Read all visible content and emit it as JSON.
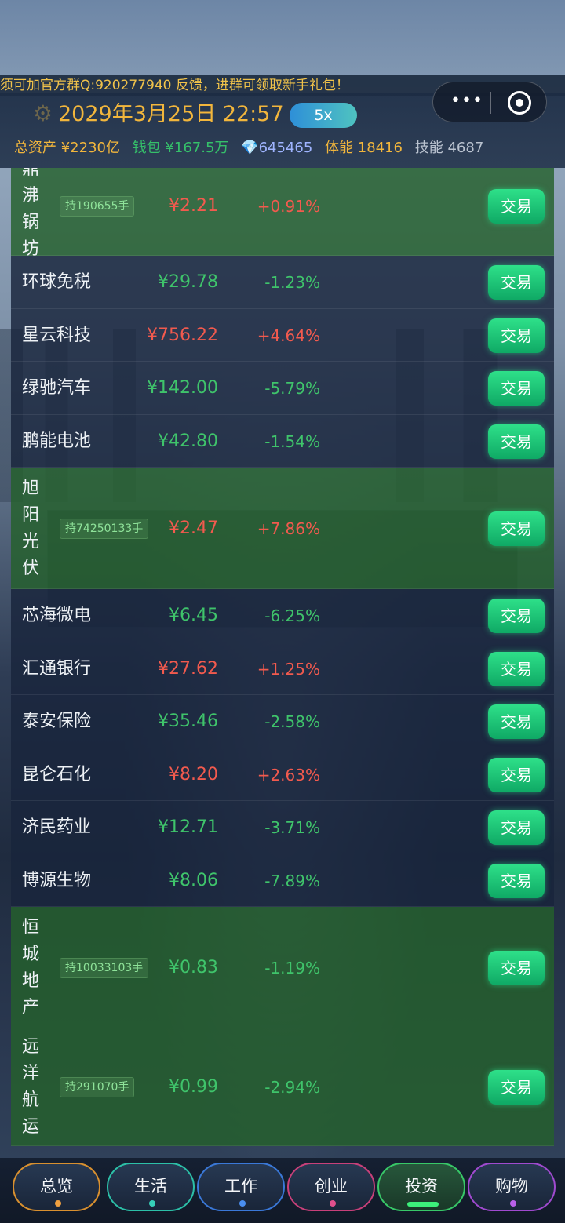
{
  "notice": "须可加官方群Q:920277940 反馈，进群可领取新手礼包！",
  "header": {
    "datetime": "2029年3月25日 22:57",
    "speed": "5x",
    "more_label": "•••",
    "stats": {
      "assets": "总资产 ¥2230亿",
      "wallet": "钱包 ¥167.5万",
      "gems": "💎645465",
      "stamina": "体能 18416",
      "skill": "技能 4687"
    }
  },
  "trade_label": "交易",
  "stocks": [
    {
      "name": "鼎沸锅坊",
      "holding": "持190655手",
      "price": "¥2.21",
      "change": "+0.91%",
      "direction": "up"
    },
    {
      "name": "环球免税",
      "holding": "",
      "price": "¥29.78",
      "change": "-1.23%",
      "direction": "down"
    },
    {
      "name": "星云科技",
      "holding": "",
      "price": "¥756.22",
      "change": "+4.64%",
      "direction": "up"
    },
    {
      "name": "绿驰汽车",
      "holding": "",
      "price": "¥142.00",
      "change": "-5.79%",
      "direction": "down"
    },
    {
      "name": "鹏能电池",
      "holding": "",
      "price": "¥42.80",
      "change": "-1.54%",
      "direction": "down"
    },
    {
      "name": "旭阳光伏",
      "holding": "持74250133手",
      "price": "¥2.47",
      "change": "+7.86%",
      "direction": "up"
    },
    {
      "name": "芯海微电",
      "holding": "",
      "price": "¥6.45",
      "change": "-6.25%",
      "direction": "down"
    },
    {
      "name": "汇通银行",
      "holding": "",
      "price": "¥27.62",
      "change": "+1.25%",
      "direction": "up"
    },
    {
      "name": "泰安保险",
      "holding": "",
      "price": "¥35.46",
      "change": "-2.58%",
      "direction": "down"
    },
    {
      "name": "昆仑石化",
      "holding": "",
      "price": "¥8.20",
      "change": "+2.63%",
      "direction": "up"
    },
    {
      "name": "济民药业",
      "holding": "",
      "price": "¥12.71",
      "change": "-3.71%",
      "direction": "down"
    },
    {
      "name": "博源生物",
      "holding": "",
      "price": "¥8.06",
      "change": "-7.89%",
      "direction": "down"
    },
    {
      "name": "恒城地产",
      "holding": "持10033103手",
      "price": "¥0.83",
      "change": "-1.19%",
      "direction": "down"
    },
    {
      "name": "远洋航运",
      "holding": "持291070手",
      "price": "¥0.99",
      "change": "-2.94%",
      "direction": "down"
    }
  ],
  "tabs": [
    {
      "label": "总览"
    },
    {
      "label": "生活"
    },
    {
      "label": "工作"
    },
    {
      "label": "创业"
    },
    {
      "label": "投资",
      "active": true
    },
    {
      "label": "购物"
    }
  ]
}
